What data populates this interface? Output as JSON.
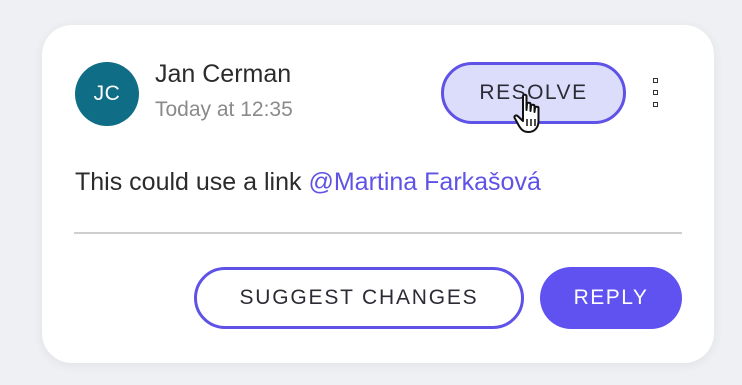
{
  "comment": {
    "avatar_initials": "JC",
    "author_name": "Jan Cerman",
    "timestamp": "Today at 12:35",
    "text": "This could use a link",
    "mention": "@Martina Farkašová"
  },
  "actions": {
    "resolve_label": "RESOLVE",
    "suggest_label": "SUGGEST CHANGES",
    "reply_label": "REPLY"
  },
  "icons": {
    "more": "more-vertical-icon",
    "cursor": "hand-pointer-icon"
  },
  "colors": {
    "accent": "#5f52e6",
    "resolve_bg": "#dcdcfb",
    "avatar_bg": "#0f6d86",
    "reply_bg": "#5f52f0"
  }
}
